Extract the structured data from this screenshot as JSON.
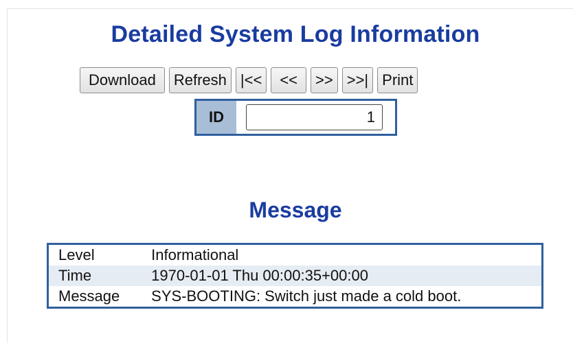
{
  "page": {
    "title": "Detailed System Log Information"
  },
  "toolbar": {
    "download_label": "Download",
    "refresh_label": "Refresh",
    "first_label": "|<<",
    "prev_label": "<<",
    "next_label": ">>",
    "last_label": ">>|",
    "print_label": "Print"
  },
  "id_field": {
    "label": "ID",
    "value": "1"
  },
  "message_section": {
    "title": "Message",
    "rows": [
      {
        "key": "Level",
        "value": "Informational"
      },
      {
        "key": "Time",
        "value": "1970-01-01 Thu 00:00:35+00:00"
      },
      {
        "key": "Message",
        "value": "SYS-BOOTING: Switch just made a cold boot."
      }
    ]
  },
  "colors": {
    "heading": "#1a3ca0",
    "table_border": "#2f5f9e",
    "id_label_bg": "#a8bdd6",
    "alt_row_bg": "#e6ecf4"
  }
}
